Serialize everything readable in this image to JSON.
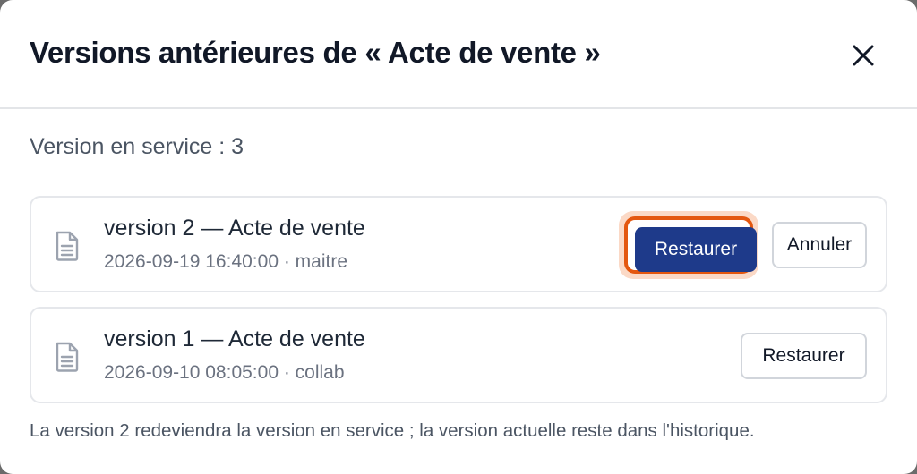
{
  "dialog": {
    "title": "Versions antérieures de « Acte de vente »",
    "current_version_text": "Version en service : 3",
    "footer_note": "La version 2 redeviendra la version en service ; la version actuelle reste dans l'historique."
  },
  "versions": [
    {
      "title": "version 2 — Acte de vente",
      "meta": "2026-09-19 16:40:00 · maitre",
      "restore_label": "Restaurer",
      "cancel_label": "Annuler"
    },
    {
      "title": "version 1 — Acte de vente",
      "meta": "2026-09-10 08:05:00 · collab",
      "restore_label": "Restaurer"
    }
  ],
  "icons": {
    "close": "close-icon",
    "document": "document-icon"
  },
  "colors": {
    "primary": "#1e3a8a",
    "focus_ring": "#e4570f",
    "title": "#111827",
    "muted": "#6b7280"
  }
}
